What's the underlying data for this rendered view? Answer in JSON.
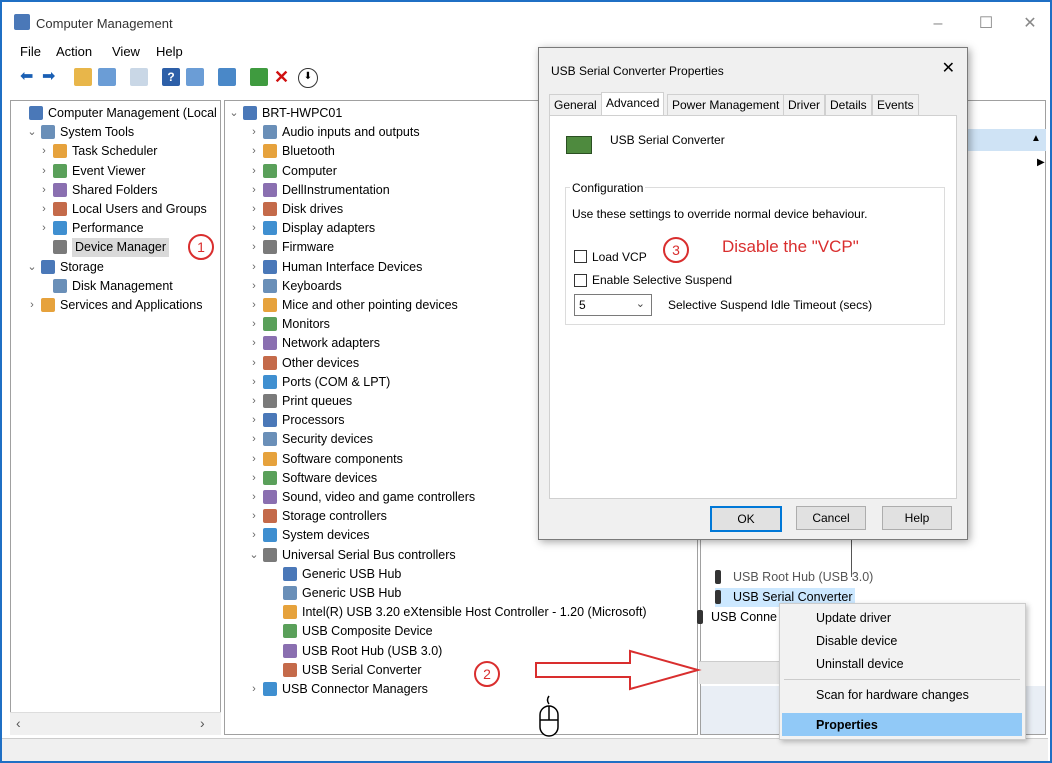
{
  "window": {
    "title": "Computer Management"
  },
  "menu": [
    "File",
    "Action",
    "View",
    "Help"
  ],
  "left_tree": [
    {
      "label": "Computer Management (Local",
      "level": 0,
      "chev": ""
    },
    {
      "label": "System Tools",
      "level": 1,
      "chev": "˅"
    },
    {
      "label": "Task Scheduler",
      "level": 2,
      "chev": "›"
    },
    {
      "label": "Event Viewer",
      "level": 2,
      "chev": "›"
    },
    {
      "label": "Shared Folders",
      "level": 2,
      "chev": "›"
    },
    {
      "label": "Local Users and Groups",
      "level": 2,
      "chev": "›"
    },
    {
      "label": "Performance",
      "level": 2,
      "chev": "›"
    },
    {
      "label": "Device Manager",
      "level": 2,
      "chev": "",
      "selected": true
    },
    {
      "label": "Storage",
      "level": 1,
      "chev": "˅"
    },
    {
      "label": "Disk Management",
      "level": 2,
      "chev": ""
    },
    {
      "label": "Services and Applications",
      "level": 1,
      "chev": "›"
    }
  ],
  "device_tree": [
    {
      "label": "BRT-HWPC01",
      "level": 0,
      "chev": "˅"
    },
    {
      "label": "Audio inputs and outputs",
      "level": 1,
      "chev": "›"
    },
    {
      "label": "Bluetooth",
      "level": 1,
      "chev": "›"
    },
    {
      "label": "Computer",
      "level": 1,
      "chev": "›"
    },
    {
      "label": "DellInstrumentation",
      "level": 1,
      "chev": "›"
    },
    {
      "label": "Disk drives",
      "level": 1,
      "chev": "›"
    },
    {
      "label": "Display adapters",
      "level": 1,
      "chev": "›"
    },
    {
      "label": "Firmware",
      "level": 1,
      "chev": "›"
    },
    {
      "label": "Human Interface Devices",
      "level": 1,
      "chev": "›"
    },
    {
      "label": "Keyboards",
      "level": 1,
      "chev": "›"
    },
    {
      "label": "Mice and other pointing devices",
      "level": 1,
      "chev": "›"
    },
    {
      "label": "Monitors",
      "level": 1,
      "chev": "›"
    },
    {
      "label": "Network adapters",
      "level": 1,
      "chev": "›"
    },
    {
      "label": "Other devices",
      "level": 1,
      "chev": "›"
    },
    {
      "label": "Ports (COM & LPT)",
      "level": 1,
      "chev": "›"
    },
    {
      "label": "Print queues",
      "level": 1,
      "chev": "›"
    },
    {
      "label": "Processors",
      "level": 1,
      "chev": "›"
    },
    {
      "label": "Security devices",
      "level": 1,
      "chev": "›"
    },
    {
      "label": "Software components",
      "level": 1,
      "chev": "›"
    },
    {
      "label": "Software devices",
      "level": 1,
      "chev": "›"
    },
    {
      "label": "Sound, video and game controllers",
      "level": 1,
      "chev": "›"
    },
    {
      "label": "Storage controllers",
      "level": 1,
      "chev": "›"
    },
    {
      "label": "System devices",
      "level": 1,
      "chev": "›"
    },
    {
      "label": "Universal Serial Bus controllers",
      "level": 1,
      "chev": "˅"
    },
    {
      "label": "Generic USB Hub",
      "level": 2,
      "chev": ""
    },
    {
      "label": "Generic USB Hub",
      "level": 2,
      "chev": ""
    },
    {
      "label": "Intel(R) USB 3.20 eXtensible Host Controller - 1.20 (Microsoft)",
      "level": 2,
      "chev": ""
    },
    {
      "label": "USB Composite Device",
      "level": 2,
      "chev": ""
    },
    {
      "label": "USB Root Hub (USB 3.0)",
      "level": 2,
      "chev": ""
    },
    {
      "label": "USB Serial Converter",
      "level": 2,
      "chev": ""
    },
    {
      "label": "USB Connector Managers",
      "level": 1,
      "chev": "›"
    }
  ],
  "dialog": {
    "title": "USB Serial Converter Properties",
    "tabs": [
      "General",
      "Advanced",
      "Power Management",
      "Driver",
      "Details",
      "Events"
    ],
    "active_tab": "Advanced",
    "device_name": "USB Serial Converter",
    "group_label": "Configuration",
    "description": "Use these settings to override normal device behaviour.",
    "load_vcp": "Load VCP",
    "selective_suspend": "Enable Selective Suspend",
    "timeout_value": "5",
    "timeout_label": "Selective Suspend Idle Timeout (secs)",
    "ok": "OK",
    "cancel": "Cancel",
    "help": "Help"
  },
  "right_behind": {
    "root_hub_partial": "USB Root Hub (USB 3.0)",
    "serial_converter": "USB Serial Converter",
    "usb_conne": "USB Conne"
  },
  "context_menu": [
    "Update driver",
    "Disable device",
    "Uninstall device",
    "Scan for hardware changes",
    "Properties"
  ],
  "annotations": {
    "step1": "1",
    "step2": "2",
    "step3": "3",
    "step3_text": "Disable the \"VCP\""
  },
  "colors": {
    "annotation": "#d92e2e",
    "selection": "#cce8ff",
    "menu_highlight": "#91c9f7"
  }
}
